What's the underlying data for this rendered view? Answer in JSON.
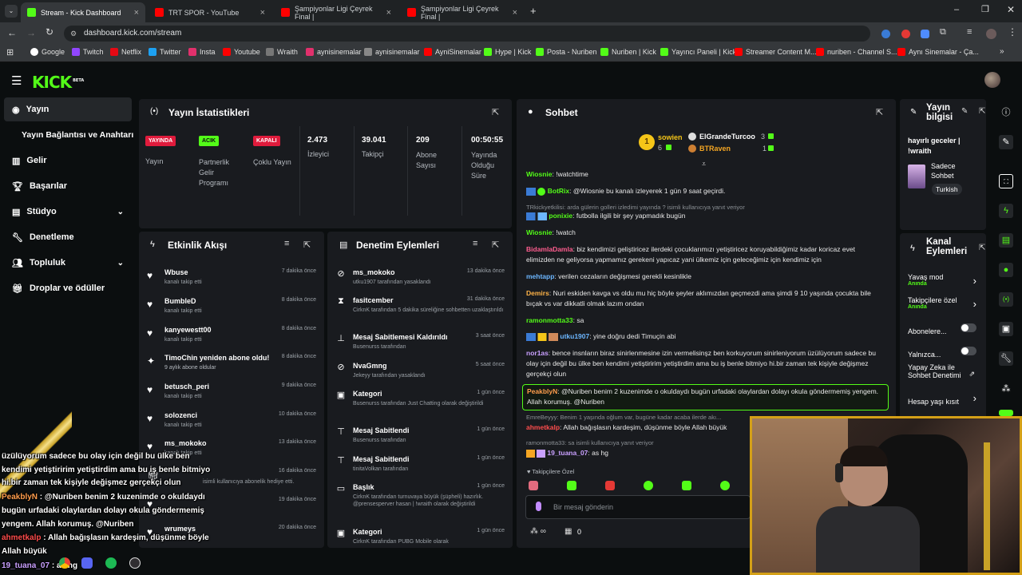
{
  "browser": {
    "tabs": [
      {
        "title": "Stream - Kick Dashboard",
        "color": "#53fc18"
      },
      {
        "title": "TRT SPOR - YouTube",
        "color": "#ff0000"
      },
      {
        "title": "Şampiyonlar Ligi Çeyrek Final |",
        "color": "#ff0000"
      },
      {
        "title": "Şampiyonlar Ligi Çeyrek Final |",
        "color": "#ff0000"
      }
    ],
    "url": "dashboard.kick.com/stream",
    "bookmarks": [
      "Google",
      "Twitch",
      "Netflix",
      "Twitter",
      "Insta",
      "Youtube",
      "Wraith",
      "aynisinemalar",
      "aynisinemalar",
      "AyniSinemalar",
      "Hype | Kick",
      "Posta - Nuriben",
      "Nuriben | Kick",
      "Yayıncı Paneli | Kick",
      "Streamer Content M...",
      "nuriben - Channel S...",
      "Aynı Sinemalar - Ça..."
    ]
  },
  "brand": {
    "logo": "KICK",
    "beta": "BETA",
    "accent": "#53fc18"
  },
  "sidebar": {
    "items": [
      {
        "label": "Yayın",
        "icon": "broadcast-icon"
      },
      {
        "label": "Yayın Bağlantısı ve Anahtarı",
        "icon": ""
      },
      {
        "label": "Gelir",
        "icon": "chart-icon"
      },
      {
        "label": "Başarılar",
        "icon": "trophy-icon"
      },
      {
        "label": "Stüdyo",
        "icon": "studio-icon"
      },
      {
        "label": "Denetleme",
        "icon": "wrench-icon"
      },
      {
        "label": "Topluluk",
        "icon": "people-icon"
      },
      {
        "label": "Droplar ve ödüller",
        "icon": "gift-icon"
      }
    ]
  },
  "stats": {
    "title": "Yayın İstatistikleri",
    "items": [
      {
        "badge": "YAYINDA",
        "label": "Yayın"
      },
      {
        "badge": "ACIK",
        "label": "Partnerlik Gelir Programı"
      },
      {
        "badge": "KAPALI",
        "label": "Çoklu Yayın"
      },
      {
        "value": "2.473",
        "label": "İzleyici"
      },
      {
        "value": "39.041",
        "label": "Takipçi"
      },
      {
        "value": "209",
        "label": "Abone Sayısı"
      },
      {
        "value": "00:50:55",
        "label": "Yayında Olduğu Süre"
      }
    ]
  },
  "events": {
    "title": "Etkinlik Akışı",
    "items": [
      {
        "name": "Wbuse",
        "sub": "kanalı takip etti",
        "time": "7 dakika önce"
      },
      {
        "name": "BumbleD",
        "sub": "kanalı takip etti",
        "time": "8 dakika önce"
      },
      {
        "name": "kanyewestt00",
        "sub": "kanalı takip etti",
        "time": "8 dakika önce"
      },
      {
        "name": "TimoChin yeniden abone oldu!",
        "sub": "9 aylık abone oldular",
        "time": "8 dakika önce"
      },
      {
        "name": "betusch_peri",
        "sub": "kanalı takip etti",
        "time": "9 dakika önce"
      },
      {
        "name": "solozenci",
        "sub": "kanalı takip etti",
        "time": "10 dakika önce"
      },
      {
        "name": "ms_mokoko",
        "sub": "kanalı takip etti",
        "time": "13 dakika önce"
      },
      {
        "name": "",
        "sub": "isimli kullanıcıya abonelik hediye etti.",
        "time": "16 dakika önce"
      },
      {
        "name": "",
        "sub": "",
        "time": "19 dakika önce"
      },
      {
        "name": "wrumeys",
        "sub": "",
        "time": "20 dakika önce"
      }
    ]
  },
  "modlog": {
    "title": "Denetim Eylemleri",
    "items": [
      {
        "name": "ms_mokoko",
        "sub": "utku1907 tarafından yasaklandı",
        "time": "13 dakika önce"
      },
      {
        "name": "fasitcember",
        "sub": "CirknK tarafından 5 dakika süreliğine sohbetten uzaklaştırıldı",
        "time": "31 dakika önce"
      },
      {
        "name": "Mesaj Sabitlemesi Kaldırıldı",
        "sub": "Busenurss tarafından",
        "time": "3 saat önce"
      },
      {
        "name": "NvaGmng",
        "sub": "Jekeyy tarafından yasaklandı",
        "time": "5 saat önce"
      },
      {
        "name": "Kategori",
        "sub": "Busenurss tarafından Just Chatting olarak değiştirildi",
        "time": "1 gün önce"
      },
      {
        "name": "Mesaj Sabitlendi",
        "sub": "Busenurss tarafından",
        "time": "1 gün önce"
      },
      {
        "name": "Mesaj Sabitlendi",
        "sub": "tinitaVolkan tarafından",
        "time": "1 gün önce"
      },
      {
        "name": "Başlık",
        "sub": "CirknK tarafından turnuvaya büyük (şüpheli) hazırlık. @prensesperver hasan | !wraith olarak değiştirildi",
        "time": "1 gün önce"
      },
      {
        "name": "Kategori",
        "sub": "CirknK tarafından PUBG Mobile olarak",
        "time": "1 gün önce"
      }
    ]
  },
  "chat": {
    "title": "Sohbet",
    "leaders": [
      {
        "rank": "1",
        "name": "sowien",
        "count": "6"
      },
      {
        "name": "ElGrandeTurcoo",
        "count": "3"
      },
      {
        "name": "BTRaven",
        "count": "1"
      }
    ],
    "messages": [
      {
        "user": "Wiosnie",
        "text": "!watchtime",
        "color": "#53fc18"
      },
      {
        "user": "BotRix",
        "text": "@Wiosnie bu kanalı izleyerek 1 gün 9 saat geçirdi.",
        "color": "#53fc18"
      },
      {
        "reply": "TRkickyetkilisi: arda gülerin golleri izledimi yayında ? isimli kullanıcıya yanıt veriyor"
      },
      {
        "user": "ponixie",
        "text": "futbolla ilgili bir şey yapmadık bugün",
        "color": "#53fc18"
      },
      {
        "user": "Wiosnie",
        "text": "!watch",
        "color": "#53fc18"
      },
      {
        "user": "BidamlaDamla",
        "text": "biz kendimizi geliştiricez ilerdeki çocuklarımızı yetiştiricez koruyabildiğimiz kadar koricaz evet elimizden ne geliyorsa yapmamız gerekeni yapıcaz yani ülkemiz için geleceğimiz için kendimiz için",
        "color": "#ff5d8f"
      },
      {
        "user": "mehtapp",
        "text": "verilen cezaların değişmesi gerekli kesinlikle",
        "color": "#6cb6ff"
      },
      {
        "user": "Demirs",
        "text": "Nuri eskiden kavga vs oldu mu hiç böyle şeyler aklımızdan geçmezdi ama şimdi 9 10 yaşında çocukta bile bıçak vs var dikkatli olmak lazım ondan",
        "color": "#ffb347"
      },
      {
        "user": "ramonmotta33",
        "text": "sa",
        "color": "#53fc18"
      },
      {
        "user": "utku1907",
        "text": "yine doğru dedi Timuçin abi",
        "color": "#6cb6ff"
      },
      {
        "user": "nor1as",
        "text": "bence insnların biraz sinirlenmesine izin vermelisinşz ben korkuyorum sinirleniyorum üzülüyorum sadece bu olay için değil bu ülke ben kendimi yetiştiririm yetiştirdim ama bu iş benle bitmiyo hi.bir zaman tek kişiyle değişmez gerçekçi olun",
        "color": "#c9a0ff"
      },
      {
        "user": "PeakblyN",
        "text": "@Nuriben benim 2 kuzenimde o okuldaydı bugün urfadaki olaylardan dolayı okula göndermemiş yengem. Allah korumuş. @Nuriben",
        "color": "#ff9d4d"
      },
      {
        "reply": "EmreBeyyy: Benim 1 yaşında oğlum var, bugüne kadar acaba ilerde akı..."
      },
      {
        "user": "ahmetkalp",
        "text": "Allah bağışlasın kardeşim, düşünme böyle Allah büyük",
        "color": "#ff4d4d"
      },
      {
        "reply": "ramonmotta33: sa isimli kullanıcıya yanıt veriyor"
      },
      {
        "user": "19_tuana_07",
        "text": "as hg",
        "color": "#c9a0ff"
      }
    ],
    "followers_only": "Takipçilere Özel",
    "placeholder": "Bir mesaj gönderin",
    "count": "0"
  },
  "info": {
    "title": "Yayın bilgisi",
    "stream_title": "hayırlı geceler | !wraith",
    "category": "Sadece Sohbet",
    "language": "Turkish"
  },
  "actions": {
    "title": "Kanal Eylemleri",
    "items": [
      {
        "label": "Yavaş mod",
        "sub": "Anında"
      },
      {
        "label": "Takipçilere özel",
        "sub": "Anında"
      },
      {
        "label": "Abonelere...",
        "sub": ""
      },
      {
        "label": "Yalnızca...",
        "sub": ""
      },
      {
        "label": "Yapay Zeka ile Sohbet Denetimi",
        "sub": ""
      },
      {
        "label": "Hesap yaşı kısıt",
        "sub": ""
      }
    ]
  },
  "overlay": {
    "lines": [
      {
        "user": "",
        "text": "üzülüyorum sadece bu olay için değil bu ülke ben"
      },
      {
        "user": "",
        "text": "kendimi yetiştiririm yetiştirdim ama bu iş benle bitmiyo"
      },
      {
        "user": "",
        "text": "hi.bir zaman tek kişiyle değişmez gerçekçi olun"
      },
      {
        "user": "PeakblyN",
        "text": " : @Nuriben benim 2 kuzenimde o okuldaydı"
      },
      {
        "user": "",
        "text": "bugün urfadaki olaylardan dolayı okula göndermemiş"
      },
      {
        "user": "",
        "text": "yengem. Allah korumuş. @Nuriben"
      },
      {
        "user": "ahmetkalp",
        "text": " : Allah bağışlasın kardeşim, düşünme böyle"
      },
      {
        "user": "",
        "text": "Allah büyük"
      },
      {
        "user": "19_tuana_07",
        "text": " : as hg"
      }
    ]
  }
}
